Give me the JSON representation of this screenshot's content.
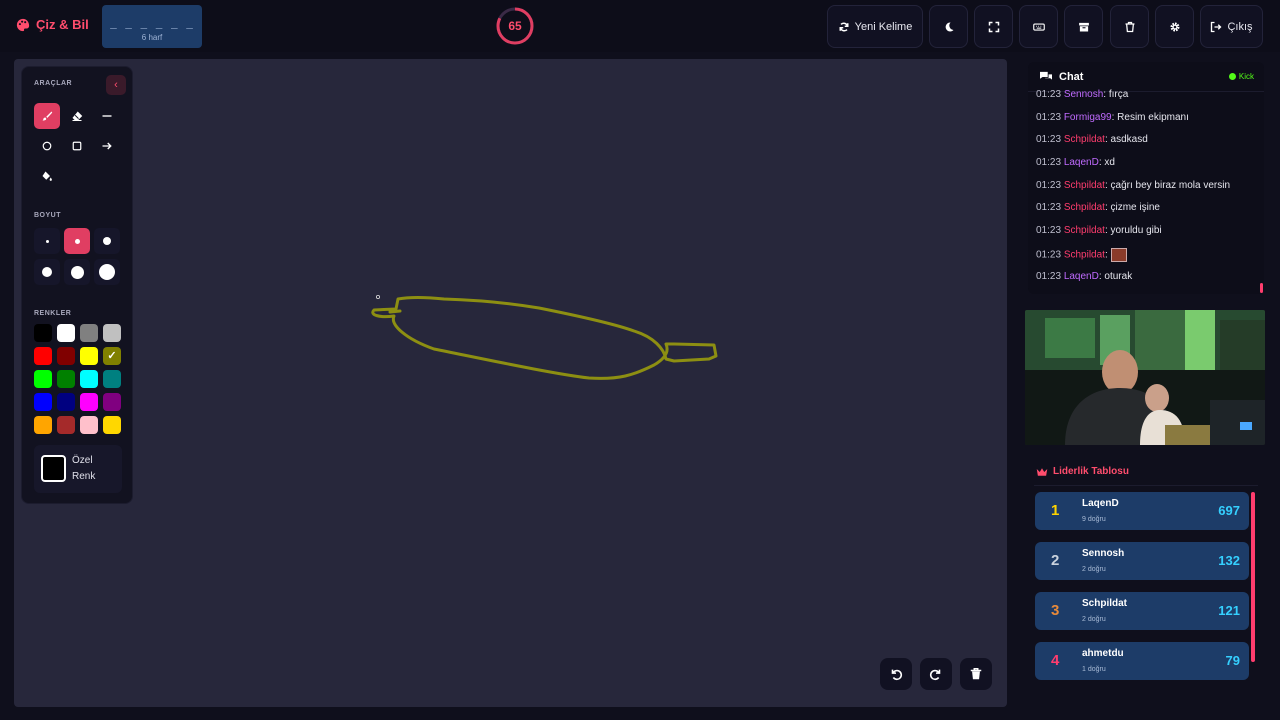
{
  "header": {
    "brand": "Çiz & Bil",
    "word_mask": "_ _ _ _ _ _",
    "word_length": "6 harf",
    "timer": "65",
    "new_word": "Yeni Kelime",
    "exit": "Çıkış"
  },
  "tools": {
    "tools_label": "ARAÇLAR",
    "size_label": "BOYUT",
    "colors_label": "RENKLER",
    "custom_color_line1": "Özel",
    "custom_color_line2": "Renk",
    "colors": [
      "#000000",
      "#ffffff",
      "#808080",
      "#c0c0c0",
      "#ff0000",
      "#800000",
      "#ffff00",
      "#808000",
      "#00ff00",
      "#008000",
      "#00ffff",
      "#008080",
      "#0000ff",
      "#000080",
      "#ff00ff",
      "#800080",
      "#ffa500",
      "#a52a2a",
      "#ffc0cb",
      "#ffd700"
    ],
    "selected_color": "#808000"
  },
  "chat": {
    "title": "Chat",
    "source": "Kick",
    "messages": [
      {
        "time": "01:23",
        "user": "Sennosh",
        "text": ": fırça",
        "color": "purple"
      },
      {
        "time": "01:23",
        "user": "Formiga99",
        "text": ": Resim ekipmanı",
        "color": "purple"
      },
      {
        "time": "01:23",
        "user": "Schpildat",
        "text": ": asdkasd",
        "color": "pink"
      },
      {
        "time": "01:23",
        "user": "LaqenD",
        "text": ": xd",
        "color": "purple"
      },
      {
        "time": "01:23",
        "user": "Schpildat",
        "text": ": çağrı bey biraz mola versin",
        "color": "pink"
      },
      {
        "time": "01:23",
        "user": "Schpildat",
        "text": ": çizme işine",
        "color": "pink"
      },
      {
        "time": "01:23",
        "user": "Schpildat",
        "text": ": yoruldu gibi",
        "color": "pink"
      },
      {
        "time": "01:23",
        "user": "Schpildat",
        "text": ": ",
        "color": "pink",
        "emote": true
      },
      {
        "time": "01:23",
        "user": "LaqenD",
        "text": ": oturak",
        "color": "purple"
      }
    ]
  },
  "leaderboard": {
    "title": "Liderlik Tablosu",
    "entries": [
      {
        "rank": "1",
        "name": "LaqenD",
        "sub": "9 doğru",
        "score": "697",
        "rank_color": "#ffd400"
      },
      {
        "rank": "2",
        "name": "Sennosh",
        "sub": "2 doğru",
        "score": "132",
        "rank_color": "#c9d2dd"
      },
      {
        "rank": "3",
        "name": "Schpildat",
        "sub": "2 doğru",
        "score": "121",
        "rank_color": "#e88a3a"
      },
      {
        "rank": "4",
        "name": "ahmetdu",
        "sub": "1 doğru",
        "score": "79",
        "rank_color": "#ff3d6e"
      }
    ]
  }
}
